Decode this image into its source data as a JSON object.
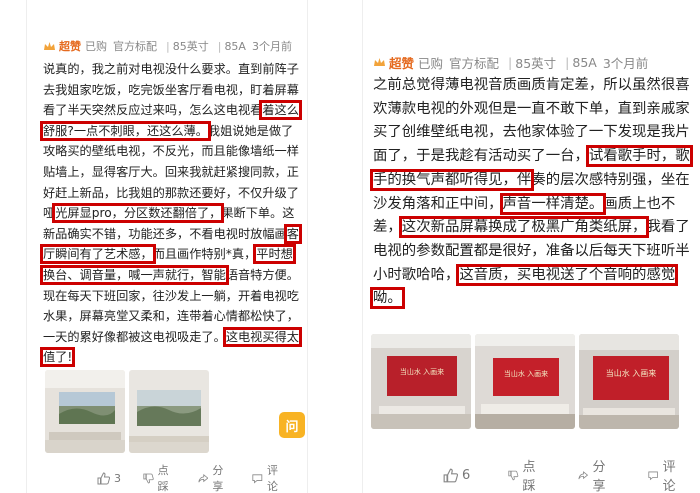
{
  "left": {
    "badge": "超赞",
    "meta": [
      "已购",
      "官方标配",
      "85英寸",
      "85A",
      "3个月前"
    ],
    "text_before": "说真的，我之前对电视没什么要求。直到前阵子去我姐家吃饭，吃完饭坐客厅看电视，盯着屏幕看了半天突然反应过来吗，怎么这电视看",
    "hl1": "着这么舒服?一点不刺眼，还这么薄。",
    "text_2": "我姐说她是做了攻略买的壁纸电视，不反光，而且能像墙纸一样贴墙上，显得客厅大。回来我就赶紧搜同款，正好赶上新品，比我姐的那款还要好，不仅升级了哑",
    "hl2": "光屏显pro，分区数还翻倍了，",
    "text_3": "果断下单。这新品确实不错，功能还多，不看电视时放幅画",
    "hl3": "客厅瞬间有了艺术感，",
    "text_4": "而且画作特别*真，",
    "hl4": "平时想换台、调音量，喊一声就行，智能",
    "text_5": "语音特方便。现在每天下班回家，往沙发上一躺，开着电视吃水果，屏幕亮堂又柔和，连带着心情都松快了，一天的累好像都被这电视吸走了。",
    "hl5": "这电视买得太值了!",
    "likes": "3",
    "dislike": "点踩",
    "share": "分享",
    "comment": "评论",
    "ask": "问"
  },
  "right": {
    "badge": "超赞",
    "meta": [
      "已购",
      "官方标配",
      "85英寸",
      "85A",
      "3个月前"
    ],
    "text_before": "之前总觉得薄电视音质画质肯定差，所以虽然很喜欢薄款电视的外观但是一直不敢下单，直到亲戚家买了创维壁纸电视，去他家体验了一下发现是我片面了，于是我趁有活动买了一台，",
    "hl1": "试看歌手时，歌手的换气声都听得见，伴",
    "text_2": "奏的层次感特别强，坐在沙发角落和正中间，",
    "hl2": "声音一样清楚。",
    "text_3": "画质上也不差，",
    "hl3": "这次新品屏幕换成了极黑广角类纸屏，",
    "text_4": "我看了电视的参数配置都是很好，准备以后每天下班听半小时歌哈哈，",
    "hl4": "这音质，买电视送了个音响的感觉呦。",
    "likes": "6",
    "dislike": "点踩",
    "share": "分享",
    "comment": "评论",
    "screen_text": "当山水 入画来"
  },
  "colors": {
    "highlight": "#cc0000",
    "badge": "#e56a1f",
    "ask_button": "#f8b324",
    "tv_screen": "#c4202a"
  }
}
